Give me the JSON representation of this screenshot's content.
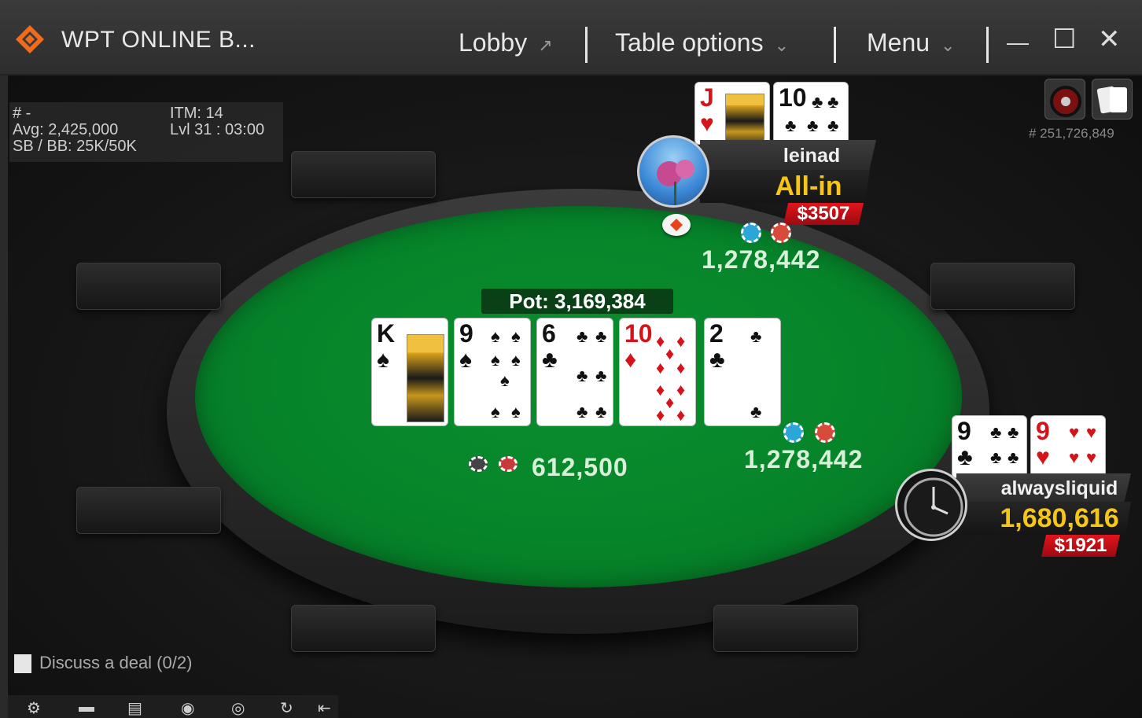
{
  "window": {
    "title": "WPT ONLINE B...",
    "lobby": "Lobby",
    "lobby_icon": "↗",
    "table_options": "Table options",
    "menu": "Menu",
    "chevron": "⌄",
    "minimize": "—",
    "maximize": "☐",
    "close": "✕"
  },
  "info": {
    "hash": "# -",
    "itm": "ITM: 14",
    "avg": "Avg: 2,425,000",
    "level": "Lvl 31 : 03:00",
    "blinds": "SB / BB: 25K/50K"
  },
  "table_id": "# 251,726,849",
  "pot": "Pot: 3,169,384",
  "board": [
    {
      "rank": "K",
      "suit": "♠",
      "color": "black"
    },
    {
      "rank": "9",
      "suit": "♠",
      "color": "black"
    },
    {
      "rank": "6",
      "suit": "♣",
      "color": "black"
    },
    {
      "rank": "10",
      "suit": "♦",
      "color": "red"
    },
    {
      "rank": "2",
      "suit": "♣",
      "color": "black"
    }
  ],
  "players": {
    "top": {
      "name": "leinad",
      "stack": "All-in",
      "bounty": "$3507",
      "bet": "1,278,442",
      "cards": [
        {
          "rank": "J",
          "suit": "♥"
        },
        {
          "rank": "10",
          "suit": "♣"
        }
      ]
    },
    "right": {
      "name": "alwaysliquid",
      "stack": "1,680,616",
      "bounty": "$1921",
      "bet": "1,278,442",
      "cards": [
        {
          "rank": "9",
          "suit": "♣"
        },
        {
          "rank": "9",
          "suit": "♥"
        }
      ]
    },
    "left_bet": "612,500"
  },
  "deal": "Discuss a deal (0/2)",
  "toolbar_icons": [
    "gear-icon",
    "chat-icon",
    "notes-icon",
    "stats-icon",
    "info-icon",
    "replay-icon",
    "exit-icon"
  ],
  "colors": {
    "felt": "#06842a",
    "stack": "#f5c518",
    "bounty": "#d4131b",
    "chip_blue": "#2aa6d8",
    "chip_red": "#d84a3a"
  }
}
